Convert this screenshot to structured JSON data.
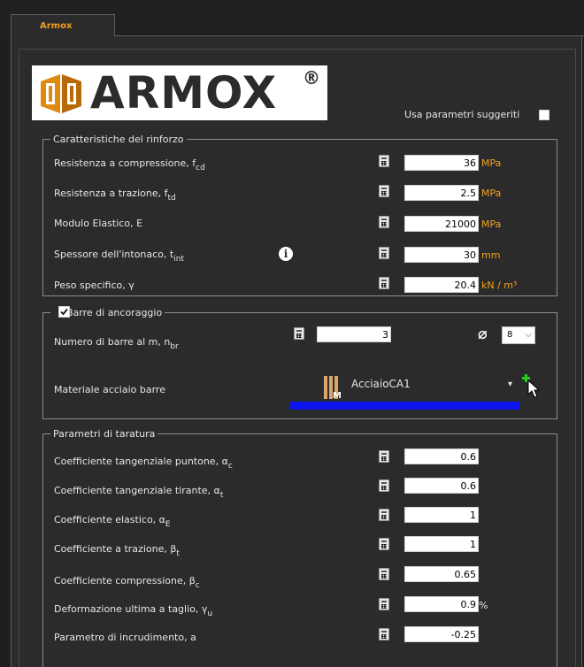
{
  "tab": {
    "label": "Armox"
  },
  "logo": {
    "text": "ARMOX",
    "reg": "®"
  },
  "suggest": {
    "label": "Usa parametri suggeriti",
    "checked": false
  },
  "rinforzo": {
    "title": "Caratteristiche del rinforzo",
    "rows": [
      {
        "label": "Resistenza a compressione, f",
        "sub": "cd",
        "value": "36",
        "unit": "MPa"
      },
      {
        "label": "Resistenza a trazione, f",
        "sub": "td",
        "value": "2.5",
        "unit": "MPa"
      },
      {
        "label": "Modulo Elastico, E",
        "sub": "",
        "value": "21000",
        "unit": "MPa"
      },
      {
        "label": "Spessore dell'intonaco, t",
        "sub": "int",
        "value": "30",
        "unit": "mm"
      },
      {
        "label": "Peso specifico,  γ",
        "sub": "",
        "value": "20.4",
        "unit": "kN / m³"
      }
    ]
  },
  "barre": {
    "title": "Barre di ancoraggio",
    "checked": true,
    "numero_label": "Numero di barre al m,  n",
    "numero_sub": "br",
    "numero_value": "3",
    "diameter_value": "8",
    "materiale_label": "Materiale acciaio barre",
    "materiale_value": "AcciaioCA1",
    "materiale_icon_letter": "M"
  },
  "taratura": {
    "title": "Parametri di taratura",
    "rows": [
      {
        "label": "Coefficiente tangenziale puntone, α",
        "sub": "c",
        "value": "0.6",
        "unit": ""
      },
      {
        "label": "Coefficiente tangenziale tirante, α",
        "sub": "t",
        "value": "0.6",
        "unit": ""
      },
      {
        "label": "Coefficiente elastico, α",
        "sub": "E",
        "value": "1",
        "unit": ""
      },
      {
        "label": "Coefficiente a trazione,  β",
        "sub": "t",
        "value": "1",
        "unit": ""
      },
      {
        "label": "Coefficiente compressione,  β",
        "sub": "c",
        "value": "0.65",
        "unit": ""
      },
      {
        "label": "Deformazione ultima a taglio, γ",
        "sub": "u",
        "value": "0.9",
        "unit": "%"
      },
      {
        "label": "Parametro di incrudimento, a",
        "sub": "",
        "value": "-0.25",
        "unit": ""
      }
    ]
  },
  "colors": {
    "accent": "#f0a020",
    "panel": "#2b2b2b",
    "progress": "#0c14f0"
  }
}
